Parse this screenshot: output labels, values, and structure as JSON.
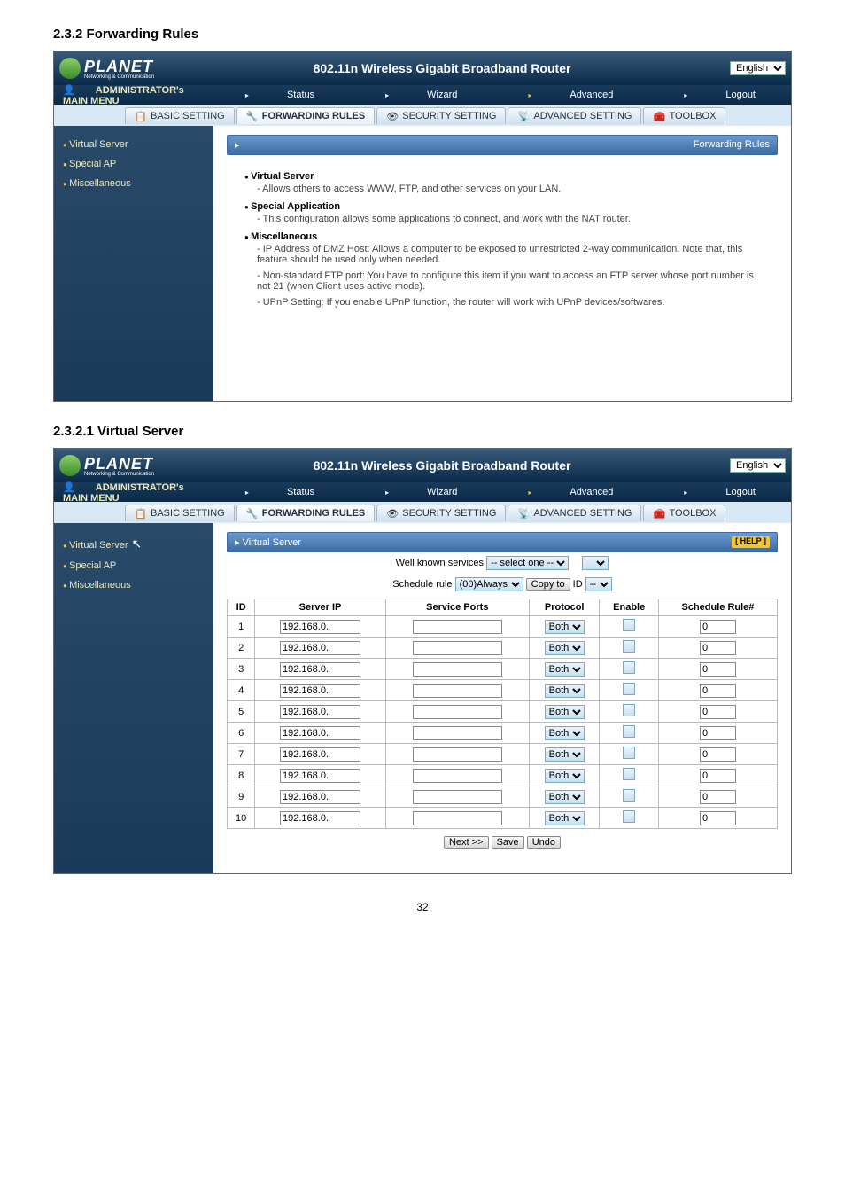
{
  "page_number": "32",
  "section1": {
    "heading": "2.3.2 Forwarding Rules",
    "logo": "PLANET",
    "logo_sub": "Networking & Communication",
    "header_title": "802.11n Wireless Gigabit Broadband Router",
    "language": "English",
    "admin_label": "ADMINISTRATOR's MAIN MENU",
    "menu": {
      "status": "Status",
      "wizard": "Wizard",
      "advanced": "Advanced",
      "logout": "Logout"
    },
    "tabs": {
      "basic": "BASIC SETTING",
      "forward": "FORWARDING RULES",
      "security": "SECURITY SETTING",
      "advset": "ADVANCED SETTING",
      "toolbox": "TOOLBOX"
    },
    "sidebar": [
      "Virtual Server",
      "Special AP",
      "Miscellaneous"
    ],
    "band_title": "Forwarding Rules",
    "items": [
      {
        "h": "Virtual Server",
        "b": "- Allows others to access WWW, FTP, and other services on your LAN."
      },
      {
        "h": "Special Application",
        "b": "- This configuration allows some applications to connect, and work with the NAT router."
      },
      {
        "h": "Miscellaneous",
        "b": "- IP Address of DMZ Host: Allows a computer to be exposed to unrestricted 2-way communication. Note that, this feature should be used only when needed.",
        "b2": "- Non-standard FTP port: You have to configure this item if you want to access an FTP server whose port number is not 21 (when Client uses active mode).",
        "b3": "- UPnP Setting: If you enable UPnP function, the router will work with UPnP devices/softwares."
      }
    ]
  },
  "section2": {
    "heading": "2.3.2.1 Virtual Server",
    "band_title": "Virtual Server",
    "help": "[ HELP ]",
    "wks_label": "Well known services",
    "wks_value": "-- select one --",
    "sched_label": "Schedule rule",
    "sched_value": "(00)Always",
    "copyto": "Copy to",
    "id_label": "ID",
    "id_value": "--",
    "columns": {
      "id": "ID",
      "serverip": "Server IP",
      "ports": "Service Ports",
      "proto": "Protocol",
      "enable": "Enable",
      "rule": "Schedule Rule#"
    },
    "rows": [
      {
        "id": "1",
        "ip": "192.168.0.",
        "proto": "Both",
        "rule": "0"
      },
      {
        "id": "2",
        "ip": "192.168.0.",
        "proto": "Both",
        "rule": "0"
      },
      {
        "id": "3",
        "ip": "192.168.0.",
        "proto": "Both",
        "rule": "0"
      },
      {
        "id": "4",
        "ip": "192.168.0.",
        "proto": "Both",
        "rule": "0"
      },
      {
        "id": "5",
        "ip": "192.168.0.",
        "proto": "Both",
        "rule": "0"
      },
      {
        "id": "6",
        "ip": "192.168.0.",
        "proto": "Both",
        "rule": "0"
      },
      {
        "id": "7",
        "ip": "192.168.0.",
        "proto": "Both",
        "rule": "0"
      },
      {
        "id": "8",
        "ip": "192.168.0.",
        "proto": "Both",
        "rule": "0"
      },
      {
        "id": "9",
        "ip": "192.168.0.",
        "proto": "Both",
        "rule": "0"
      },
      {
        "id": "10",
        "ip": "192.168.0.",
        "proto": "Both",
        "rule": "0"
      }
    ],
    "buttons": {
      "next": "Next >>",
      "save": "Save",
      "undo": "Undo"
    }
  }
}
